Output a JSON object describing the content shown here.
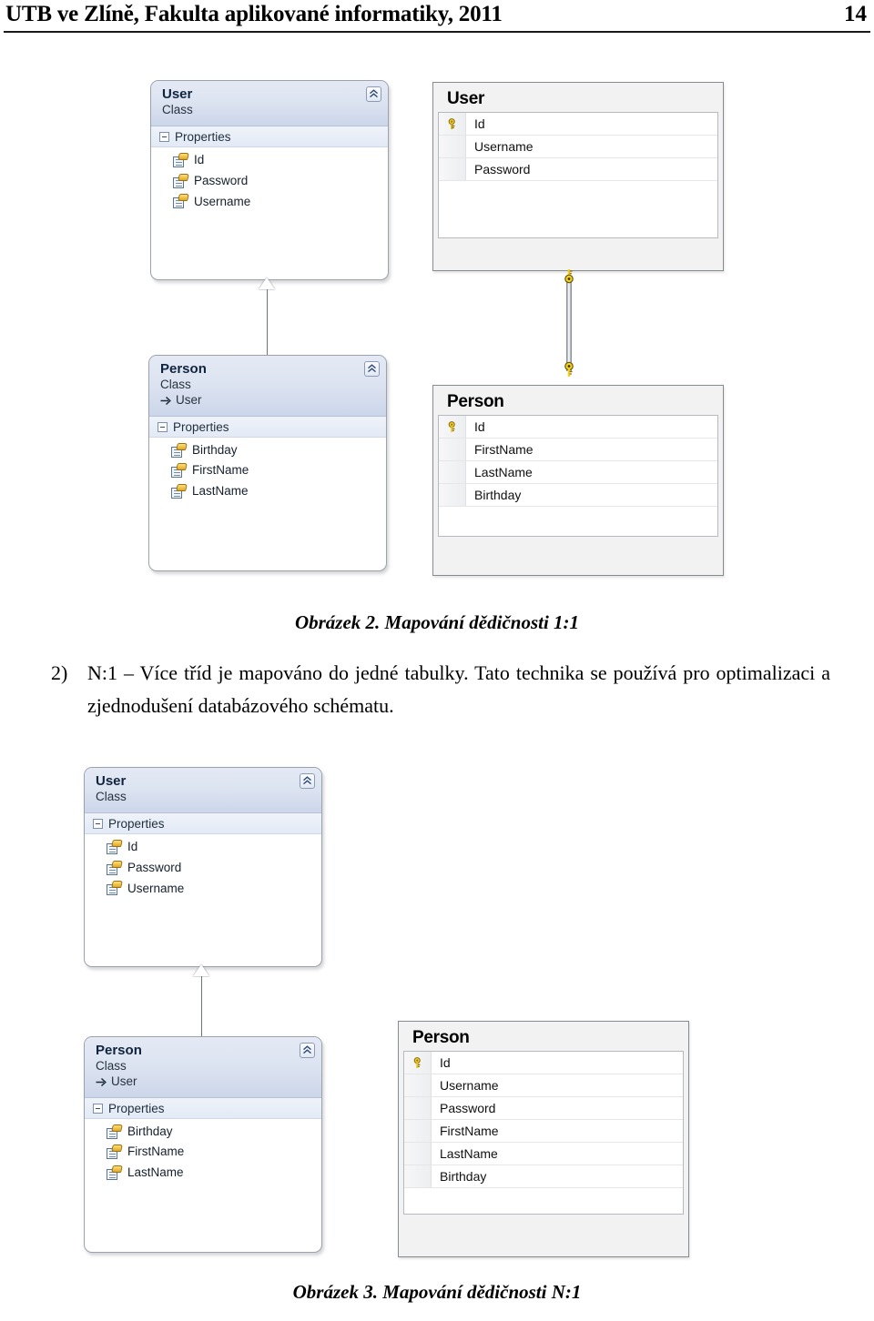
{
  "header": {
    "title": "UTB ve Zlíně, Fakulta aplikované informatiky, 2011",
    "page_number": "14"
  },
  "figure1": {
    "class_user": {
      "title": "User",
      "stereotype": "Class",
      "section": "Properties",
      "members": [
        "Id",
        "Password",
        "Username"
      ],
      "collapse_icon": "chevron-double-up-icon"
    },
    "class_person": {
      "title": "Person",
      "stereotype": "Class",
      "base": "User",
      "section": "Properties",
      "members": [
        "Birthday",
        "FirstName",
        "LastName"
      ],
      "collapse_icon": "chevron-double-up-icon"
    },
    "table_user": {
      "title": "User",
      "columns": [
        {
          "name": "Id",
          "key": true
        },
        {
          "name": "Username",
          "key": false
        },
        {
          "name": "Password",
          "key": false
        }
      ]
    },
    "table_person": {
      "title": "Person",
      "columns": [
        {
          "name": "Id",
          "key": true
        },
        {
          "name": "FirstName",
          "key": false
        },
        {
          "name": "LastName",
          "key": false
        },
        {
          "name": "Birthday",
          "key": false
        }
      ]
    },
    "relationship": "one-to-one",
    "caption": "Obrázek 2. Mapování dědičnosti 1:1"
  },
  "body": {
    "list_marker": "2)",
    "text": "N:1 – Více tříd je mapováno do jedné tabulky. Tato technika se používá pro optimalizaci a zjednodušení databázového schématu."
  },
  "figure2": {
    "class_user": {
      "title": "User",
      "stereotype": "Class",
      "section": "Properties",
      "members": [
        "Id",
        "Password",
        "Username"
      ],
      "collapse_icon": "chevron-double-up-icon"
    },
    "class_person": {
      "title": "Person",
      "stereotype": "Class",
      "base": "User",
      "section": "Properties",
      "members": [
        "Birthday",
        "FirstName",
        "LastName"
      ],
      "collapse_icon": "chevron-double-up-icon"
    },
    "table_person": {
      "title": "Person",
      "columns": [
        {
          "name": "Id",
          "key": true
        },
        {
          "name": "Username",
          "key": false
        },
        {
          "name": "Password",
          "key": false
        },
        {
          "name": "FirstName",
          "key": false
        },
        {
          "name": "LastName",
          "key": false
        },
        {
          "name": "Birthday",
          "key": false
        }
      ]
    },
    "caption": "Obrázek 3. Mapování dědičnosti N:1"
  },
  "colors": {
    "class_header_top": "#e4e9f4",
    "class_header_bottom": "#ccd6ea",
    "class_border": "#9aa2ad",
    "table_border": "#868b91",
    "table_chrome": "#f2f2f2",
    "key_yellow": "#f2d024",
    "text": "#000000"
  }
}
